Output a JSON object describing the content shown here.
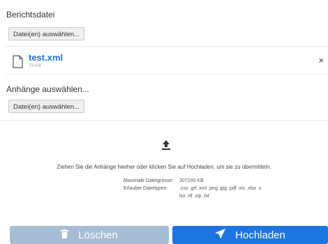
{
  "report": {
    "title": "Berichtsdatei",
    "choose_button": "Datei(en) auswählen...",
    "file": {
      "name": "test.xml",
      "size": "73 KB",
      "remove_glyph": "×"
    }
  },
  "attachments": {
    "title": "Anhänge auswählen...",
    "choose_button": "Datei(en) auswählen..."
  },
  "dropzone": {
    "instruction": "Ziehen Sie die Anhänge hierher oder klicken Sie auf Hochladen, um sie zu übermitteln.",
    "max_size_label": "Maximale Dateigrösse:",
    "max_size_value": "307200 KB",
    "allowed_label": "Erlaubte Dateitypen:",
    "allowed_value": ".csv .grf .xml .png .jpg .pdf .xls .xlsx .xlsx .rtf .zip .txt"
  },
  "buttons": {
    "delete": "Löschen",
    "upload": "Hochladen"
  },
  "colors": {
    "accent": "#1d75e3",
    "delete_disabled": "#a6bcd3",
    "link": "#1a73d9"
  },
  "icons": [
    "document-icon",
    "close-icon",
    "upload-icon",
    "trash-icon",
    "send-icon"
  ]
}
